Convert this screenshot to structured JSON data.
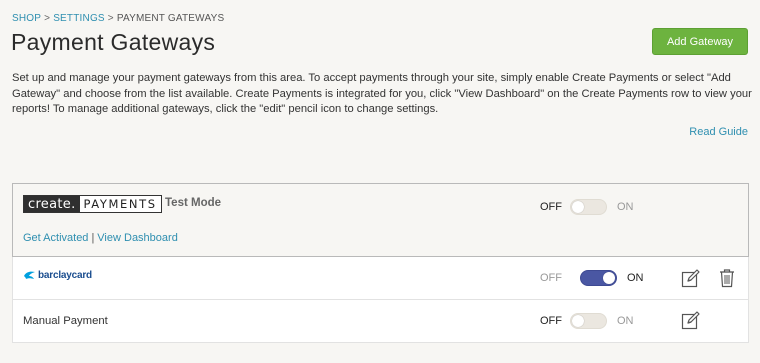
{
  "breadcrumb": {
    "shop": "SHOP",
    "settings": "SETTINGS",
    "current": "PAYMENT GATEWAYS",
    "separator": ">"
  },
  "header": {
    "title": "Payment Gateways",
    "add_gateway_label": "Add Gateway"
  },
  "description": "Set up and manage your payment gateways from this area. To accept payments through your site, simply enable Create Payments or select \"Add Gateway\" and choose from the list available. Create Payments is integrated for you, click \"View Dashboard\" on the Create Payments row to view your reports! To manage additional gateways, click the \"edit\" pencil icon to change settings.",
  "read_guide_label": "Read Guide",
  "gateways": {
    "create_payments": {
      "logo_left": "create.",
      "logo_right": "PAYMENTS",
      "mode_label": "Test Mode",
      "get_activated_label": "Get Activated",
      "link_separator": "|",
      "view_dashboard_label": "View Dashboard",
      "off_label": "OFF",
      "on_label": "ON",
      "enabled": false
    },
    "barclaycard": {
      "logo_text": "barclaycard",
      "off_label": "OFF",
      "on_label": "ON",
      "enabled": true,
      "edit_icon": "pencil-edit-icon",
      "delete_icon": "trash-icon"
    },
    "manual": {
      "name": "Manual Payment",
      "off_label": "OFF",
      "on_label": "ON",
      "enabled": false,
      "edit_icon": "pencil-edit-icon"
    }
  },
  "colors": {
    "link": "#2f8fb0",
    "add_button": "#6db33f",
    "toggle_on": "#4a57a3",
    "toggle_off": "#ebe7e0",
    "barclay_blue": "#1a4d8f"
  }
}
